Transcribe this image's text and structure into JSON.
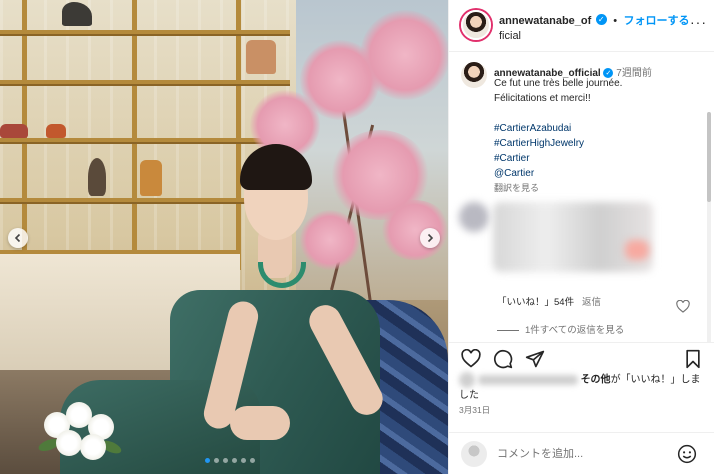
{
  "post": {
    "username": "annewatanabe_of",
    "username_cont": "ficial",
    "follow_label": "フォローする",
    "bullet": "•",
    "more": "···"
  },
  "caption": {
    "username": "annewatanabe_official",
    "age": "7週間前",
    "line1": "Ce fut une très belle journée.",
    "line2": "Félicitations et merci!!",
    "hashtags": [
      "#CartierAzabudai",
      "#CartierHighJewelry",
      "#Cartier",
      "@Cartier"
    ],
    "translate": "翻訳を見る"
  },
  "comment": {
    "likes": "「いいね！」54件",
    "reply": "返信",
    "view_replies": "1件すべての返信を見る"
  },
  "likes_line": {
    "suffix_bold": "その他",
    "suffix": "が「いいね！」しま",
    "suffix2": "した"
  },
  "date": "3月31日",
  "comment_placeholder": "コメントを追加...",
  "carousel": {
    "total": 6,
    "active_index": 0
  },
  "colors": {
    "accent": "#0095f6",
    "text": "#262626",
    "muted": "#737373",
    "hashtag": "#00376b"
  },
  "icons": [
    "verified-badge-icon",
    "more-icon",
    "prev-arrow-icon",
    "next-arrow-icon",
    "heart-icon",
    "comment-icon",
    "share-icon",
    "bookmark-icon",
    "emoji-icon"
  ]
}
